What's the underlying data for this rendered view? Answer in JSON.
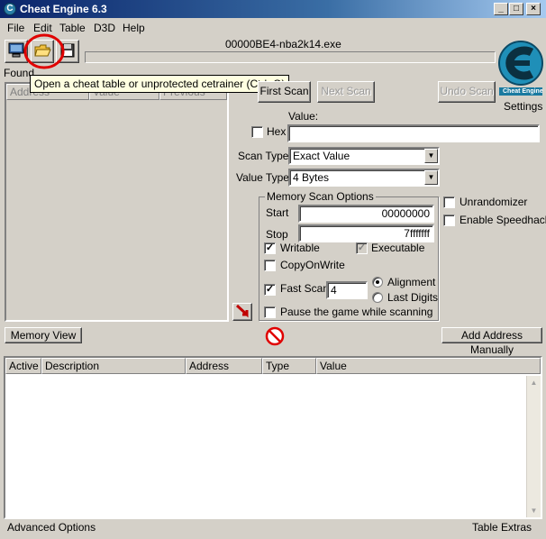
{
  "window": {
    "title": "Cheat Engine 6.3",
    "min": "_",
    "max": "□",
    "close": "×"
  },
  "menu": {
    "items": [
      "File",
      "Edit",
      "Table",
      "D3D",
      "Help"
    ]
  },
  "process_name": "00000BE4-nba2k14.exe",
  "found_label": "Found",
  "tooltip": "Open a cheat table or unprotected cetrainer (Ctrl+O)",
  "address_list": {
    "columns": [
      "Address",
      "Value",
      "Previous"
    ]
  },
  "scan": {
    "first_scan": "First Scan",
    "next_scan": "Next Scan",
    "undo_scan": "Undo Scan",
    "value_label": "Value:",
    "hex_label": "Hex",
    "value": "",
    "scan_type_label": "Scan Type",
    "scan_type_value": "Exact Value",
    "value_type_label": "Value Type",
    "value_type_value": "4 Bytes"
  },
  "logo": {
    "settings_label": "Settings",
    "logo_text": "Cheat Engine"
  },
  "memory_scan_options": {
    "title": "Memory Scan Options",
    "start_label": "Start",
    "start_value": "00000000",
    "stop_label": "Stop",
    "stop_value": "7fffffff",
    "writable_label": "Writable",
    "executable_label": "Executable",
    "copyonwrite_label": "CopyOnWrite",
    "fast_scan_label": "Fast Scan",
    "fast_scan_value": "4",
    "alignment_label": "Alignment",
    "last_digits_label": "Last Digits",
    "pause_label": "Pause the game while scanning"
  },
  "extra": {
    "unrandomizer": "Unrandomizer",
    "speedhack": "Enable Speedhack"
  },
  "memory_view": "Memory View",
  "add_address": "Add Address Manually",
  "cheat_table": {
    "columns": [
      "Active",
      "Description",
      "Address",
      "Type",
      "Value"
    ]
  },
  "status_bar": {
    "left": "Advanced Options",
    "right": "Table Extras"
  },
  "colors": {
    "highlight_circle": "#e00000",
    "title_bar": "#0a246a",
    "tooltip_bg": "#ffffe1"
  }
}
